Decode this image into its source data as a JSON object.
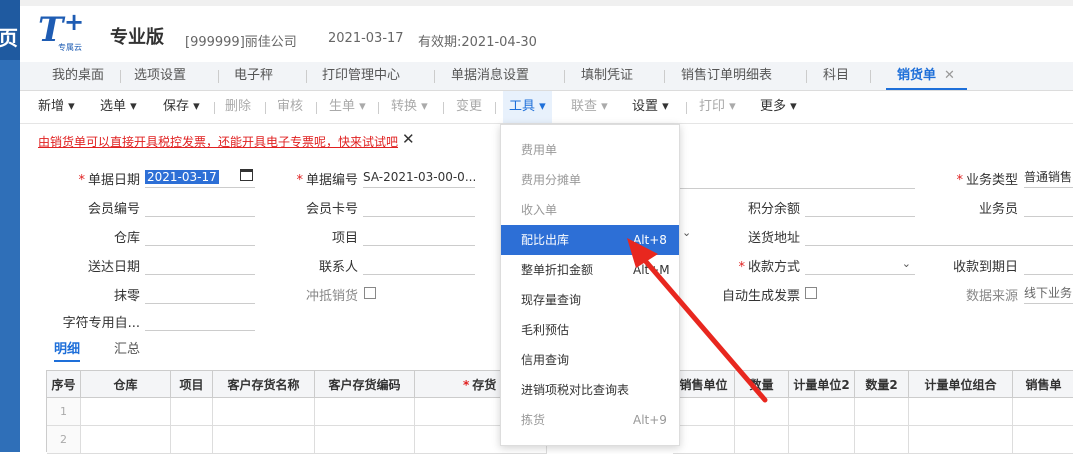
{
  "left_strip": {
    "glyph": "页"
  },
  "header": {
    "logo_text": "T",
    "logo_plus": "+",
    "logo_sub": "专属云",
    "edition": "专业版",
    "company": "[999999]丽佳公司",
    "date": "2021-03-17",
    "valid_until": "有效期:2021-04-30"
  },
  "tabs": [
    "我的桌面",
    "选项设置",
    "电子秤",
    "打印管理中心",
    "单据消息设置",
    "填制凭证",
    "销售订单明细表",
    "科目",
    "销货单"
  ],
  "active_tab_close": "✕",
  "toolbar": {
    "new": "新增 ▾",
    "select_doc": "选单 ▾",
    "save": "保存 ▾",
    "delete": "删除",
    "audit": "审核",
    "generate": "生单 ▾",
    "convert": "转换 ▾",
    "change": "变更",
    "tools": "工具 ▾",
    "linked_query": "联查 ▾",
    "settings": "设置 ▾",
    "print": "打印 ▾",
    "more": "更多 ▾"
  },
  "notice": {
    "text": "由销货单可以直接开具税控发票，还能开具电子专票呢，快来试试吧",
    "close": "✕"
  },
  "form": {
    "doc_date_label": "单据日期",
    "doc_date_value": "2021-03-17",
    "doc_no_label": "单据编号",
    "doc_no_value": "SA-2021-03-00-0...",
    "biz_type_label": "业务类型",
    "biz_type_value": "普通销售",
    "member_no_label": "会员编号",
    "member_card_label": "会员卡号",
    "points_label": "积分余额",
    "salesman_label": "业务员",
    "warehouse_label": "仓库",
    "project_label": "项目",
    "ship_addr_label": "送货地址",
    "delivery_date_label": "送达日期",
    "contact_label": "联系人",
    "pay_method_label": "收款方式",
    "due_date_label": "收款到期日",
    "rounding_label": "抹零",
    "offset_sales_label": "冲抵销货",
    "auto_invoice_label": "自动生成发票",
    "data_source_label": "数据来源",
    "data_source_value": "线下业务",
    "custom_char_label": "字符专用自..."
  },
  "detail_tabs": [
    "明细",
    "汇总"
  ],
  "grid": {
    "headers": [
      "序号",
      "仓库",
      "项目",
      "客户存货名称",
      "客户存货编码",
      "存货",
      "",
      "销售单位",
      "数量",
      "计量单位2",
      "数量2",
      "计量单位组合",
      "销售单"
    ],
    "rows": [
      "1",
      "2"
    ]
  },
  "tools_menu": [
    {
      "label": "费用单",
      "shortcut": "",
      "disabled": true
    },
    {
      "label": "费用分摊单",
      "shortcut": "",
      "disabled": true
    },
    {
      "label": "收入单",
      "shortcut": "",
      "disabled": true
    },
    {
      "label": "配比出库",
      "shortcut": "Alt+8",
      "highlighted": true
    },
    {
      "label": "整单折扣金额",
      "shortcut": "Alt+M"
    },
    {
      "label": "现存量查询",
      "shortcut": ""
    },
    {
      "label": "毛利预估",
      "shortcut": ""
    },
    {
      "label": "信用查询",
      "shortcut": ""
    },
    {
      "label": "进销项税对比查询表",
      "shortcut": ""
    },
    {
      "label": "拣货",
      "shortcut": "Alt+9",
      "disabled": true
    }
  ],
  "colors": {
    "brand_blue": "#1e5cb3",
    "accent": "#2d6fd6",
    "notice_red": "#e02020",
    "arrow_red": "#e8271f"
  }
}
